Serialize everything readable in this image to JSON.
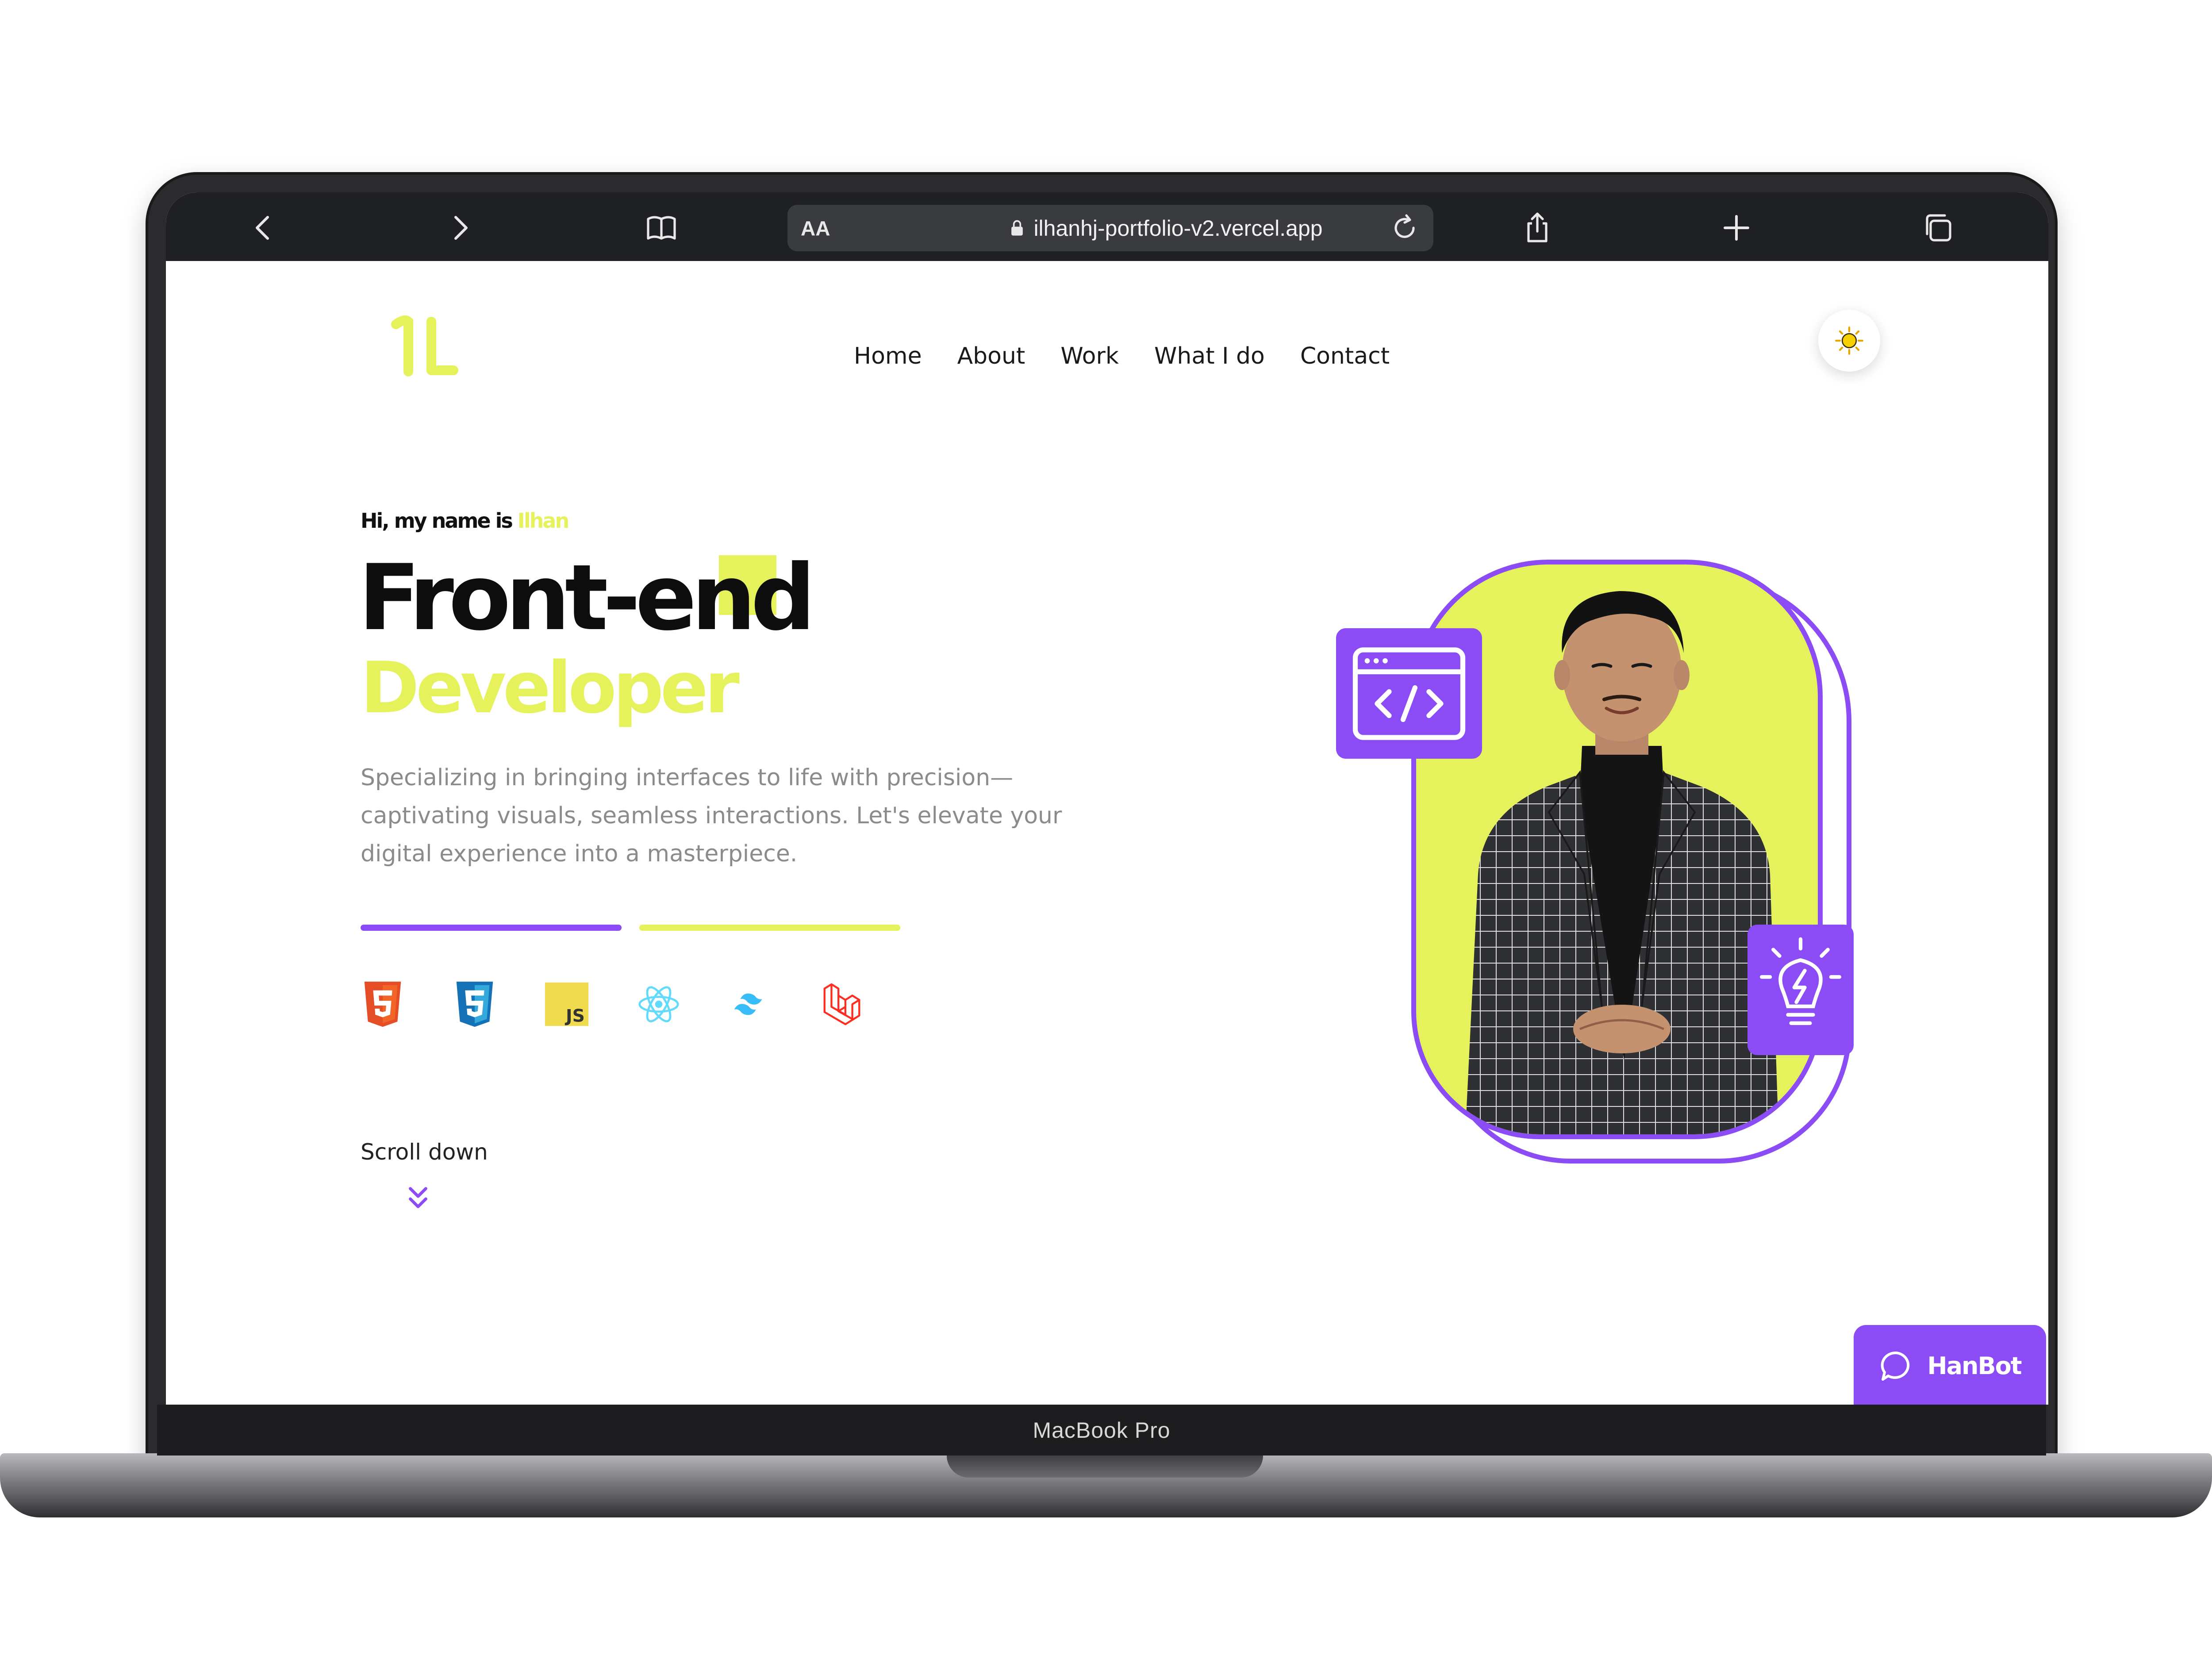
{
  "device": {
    "label": "MacBook Pro"
  },
  "browser": {
    "text_size_label": "AA",
    "url": "ilhanhj-portfolio-v2.vercel.app",
    "icons": [
      "back-icon",
      "forward-icon",
      "bookmarks-icon",
      "lock-icon",
      "reload-icon",
      "share-icon",
      "new-tab-icon",
      "tabs-icon"
    ]
  },
  "nav": {
    "items": [
      "Home",
      "About",
      "Work",
      "What I do",
      "Contact"
    ]
  },
  "hero": {
    "greeting_prefix": "Hi, my name is ",
    "greeting_name": "Ilhan",
    "title_line1": "Front-end",
    "title_line2": "Developer",
    "description": "Specializing in bringing interfaces to life with precision—captivating visuals, seamless interactions. Let's elevate your digital experience into a masterpiece.",
    "tech_icons": [
      "html5-icon",
      "css3-icon",
      "javascript-icon",
      "react-icon",
      "tailwind-icon",
      "laravel-icon"
    ],
    "scroll_label": "Scroll down"
  },
  "chat": {
    "label": "HanBot"
  },
  "colors": {
    "accent_lime": "#e6f25b",
    "accent_purple": "#8b4cf5",
    "toolbar": "#1f2023"
  }
}
